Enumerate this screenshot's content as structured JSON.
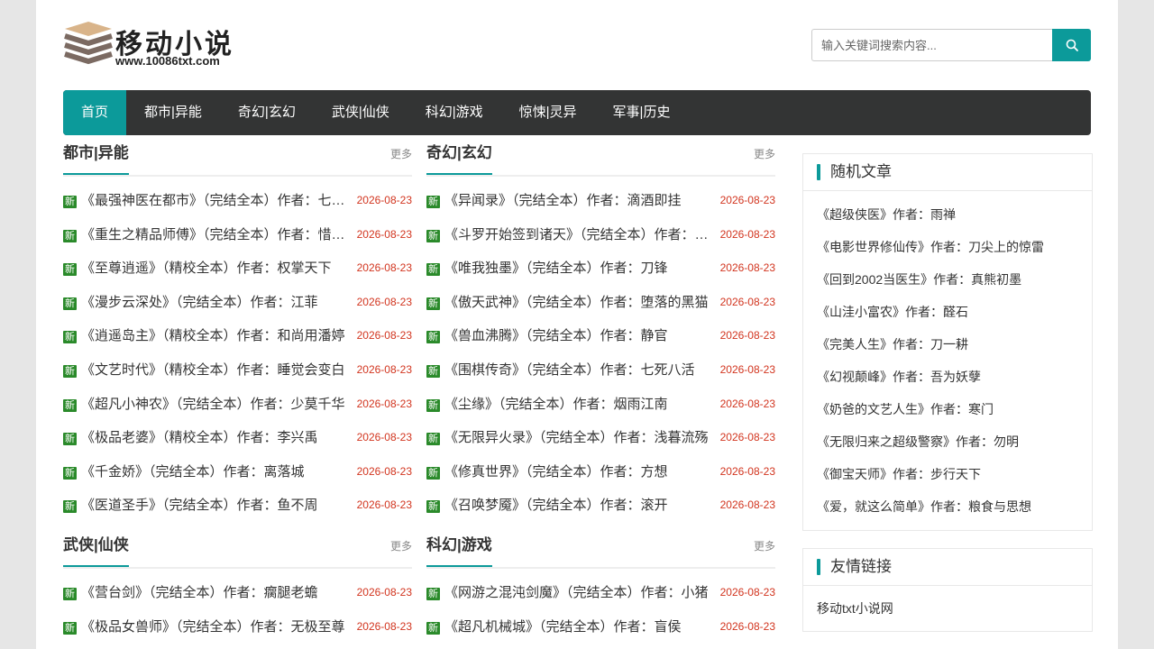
{
  "logo": {
    "text": "移动小说",
    "url": "www.10086txt.com"
  },
  "search": {
    "placeholder": "输入关键词搜索内容..."
  },
  "nav": [
    "首页",
    "都市|异能",
    "奇幻|玄幻",
    "武侠|仙侠",
    "科幻|游戏",
    "惊悚|灵异",
    "军事|历史"
  ],
  "sections": [
    {
      "title": "都市|异能",
      "more": "更多",
      "items": [
        {
          "badge": "新",
          "title": "《最强神医在都市》（完结全本）作者：七月雪",
          "date": "2026-08-23"
        },
        {
          "badge": "新",
          "title": "《重生之精品师傅》（完结全本）作者：惜墨不语",
          "date": "2026-08-23"
        },
        {
          "badge": "新",
          "title": "《至尊逍遥》（精校全本）作者：权掌天下",
          "date": "2026-08-23"
        },
        {
          "badge": "新",
          "title": "《漫步云深处》（完结全本）作者：江菲",
          "date": "2026-08-23"
        },
        {
          "badge": "新",
          "title": "《逍遥岛主》（精校全本）作者：和尚用潘婷",
          "date": "2026-08-23"
        },
        {
          "badge": "新",
          "title": "《文艺时代》（精校全本）作者：睡觉会变白",
          "date": "2026-08-23"
        },
        {
          "badge": "新",
          "title": "《超凡小神农》（完结全本）作者：少莫千华",
          "date": "2026-08-23"
        },
        {
          "badge": "新",
          "title": "《极品老婆》（精校全本）作者：李兴禹",
          "date": "2026-08-23"
        },
        {
          "badge": "新",
          "title": "《千金娇》（完结全本）作者：离落城",
          "date": "2026-08-23"
        },
        {
          "badge": "新",
          "title": "《医道圣手》（完结全本）作者：鱼不周",
          "date": "2026-08-23"
        }
      ]
    },
    {
      "title": "奇幻|玄幻",
      "more": "更多",
      "items": [
        {
          "badge": "新",
          "title": "《异闻录》（完结全本）作者：滴酒即挂",
          "date": "2026-08-23"
        },
        {
          "badge": "新",
          "title": "《斗罗开始签到诸天》（完结全本）作者：落叶",
          "date": "2026-08-23"
        },
        {
          "badge": "新",
          "title": "《唯我独墨》（完结全本）作者：刀锋",
          "date": "2026-08-23"
        },
        {
          "badge": "新",
          "title": "《傲天武神》（完结全本）作者：堕落的黑猫",
          "date": "2026-08-23"
        },
        {
          "badge": "新",
          "title": "《兽血沸腾》（完结全本）作者：静官",
          "date": "2026-08-23"
        },
        {
          "badge": "新",
          "title": "《围棋传奇》（完结全本）作者：七死八活",
          "date": "2026-08-23"
        },
        {
          "badge": "新",
          "title": "《尘缘》（完结全本）作者：烟雨江南",
          "date": "2026-08-23"
        },
        {
          "badge": "新",
          "title": "《无限异火录》（完结全本）作者：浅暮流殇",
          "date": "2026-08-23"
        },
        {
          "badge": "新",
          "title": "《修真世界》（完结全本）作者：方想",
          "date": "2026-08-23"
        },
        {
          "badge": "新",
          "title": "《召唤梦魇》（完结全本）作者：滚开",
          "date": "2026-08-23"
        }
      ]
    },
    {
      "title": "武侠|仙侠",
      "more": "更多",
      "items": [
        {
          "badge": "新",
          "title": "《营台剑》（完结全本）作者：瘸腿老蟾",
          "date": "2026-08-23"
        },
        {
          "badge": "新",
          "title": "《极品女兽师》（完结全本）作者：无极至尊",
          "date": "2026-08-23"
        }
      ]
    },
    {
      "title": "科幻|游戏",
      "more": "更多",
      "items": [
        {
          "badge": "新",
          "title": "《网游之混沌剑魔》（完结全本）作者：小猪",
          "date": "2026-08-23"
        },
        {
          "badge": "新",
          "title": "《超凡机械城》（完结全本）作者：盲侯",
          "date": "2026-08-23"
        }
      ]
    }
  ],
  "sidebar": {
    "random_title": "随机文章",
    "random": [
      "《超级侠医》作者：雨禅",
      "《电影世界修仙传》作者：刀尖上的惊雷",
      "《回到2002当医生》作者：真熊初墨",
      "《山洼小富农》作者：醛石",
      "《完美人生》作者：刀一耕",
      "《幻视颠峰》作者：吾为妖孽",
      "《奶爸的文艺人生》作者：寒门",
      "《无限归来之超级警察》作者：勿明",
      "《御宝天师》作者：步行天下",
      "《爱，就这么简单》作者：粮食与思想"
    ],
    "links_title": "友情链接",
    "links": [
      "移动txt小说网"
    ]
  },
  "colors": {
    "accent": "#0c9a9a",
    "nav_bg": "#333434",
    "date": "#d2351f",
    "badge": "#2a8a2a"
  },
  "icons": {
    "search": "search-icon",
    "logo": "book-stack-icon"
  }
}
